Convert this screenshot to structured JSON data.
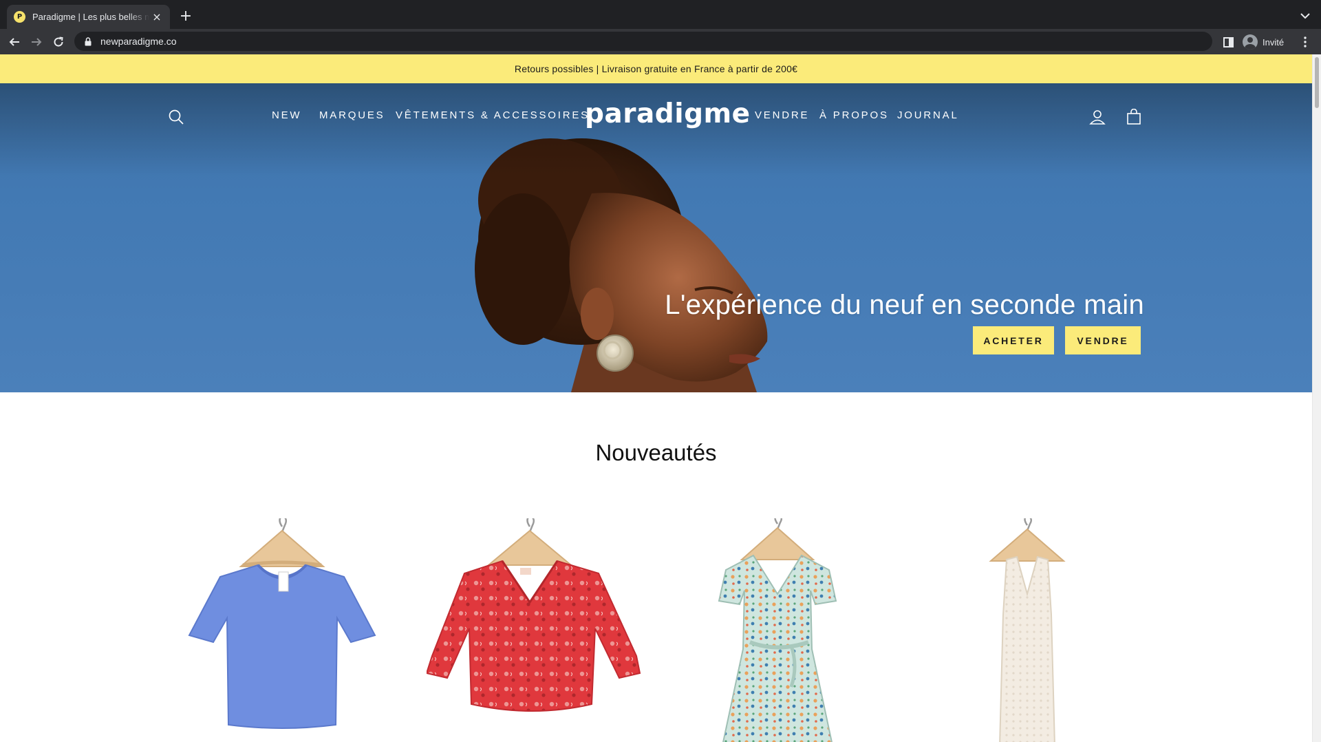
{
  "browser": {
    "tab_title": "Paradigme | Les plus belles marques",
    "tab_favicon": "P",
    "close_glyph": "×",
    "new_tab_glyph": "+",
    "url": "newparadigme.co",
    "profile_label": "Invité",
    "icons": [
      "back-arrow-icon",
      "forward-arrow-icon",
      "reload-icon",
      "lock-icon",
      "side-panel-icon",
      "profile-icon",
      "kebab-menu-icon",
      "tab-search-icon"
    ]
  },
  "announcement": {
    "text": "Retours possibles | Livraison gratuite en France à partir de 200€"
  },
  "header": {
    "logo": "paradigme",
    "nav_left": [
      "NEW",
      "MARQUES",
      "VÊTEMENTS & ACCESSOIRES"
    ],
    "nav_right": [
      "VENDRE",
      "À PROPOS",
      "JOURNAL"
    ],
    "icons": [
      "search-icon",
      "account-icon",
      "cart-icon"
    ]
  },
  "hero": {
    "heading": "L'expérience du neuf en seconde main",
    "buttons": {
      "buy": "ACHETER",
      "sell": "VENDRE"
    }
  },
  "new_arrivals": {
    "title": "Nouveautés",
    "products": [
      {
        "kind": "blue-knit-top"
      },
      {
        "kind": "red-floral-blouse"
      },
      {
        "kind": "floral-wrap-dress"
      },
      {
        "kind": "cream-knit-dress"
      }
    ]
  },
  "colors": {
    "accent_yellow": "#fbeb7a",
    "sky_blue": "#4279b3",
    "chrome_dark": "#202124"
  }
}
